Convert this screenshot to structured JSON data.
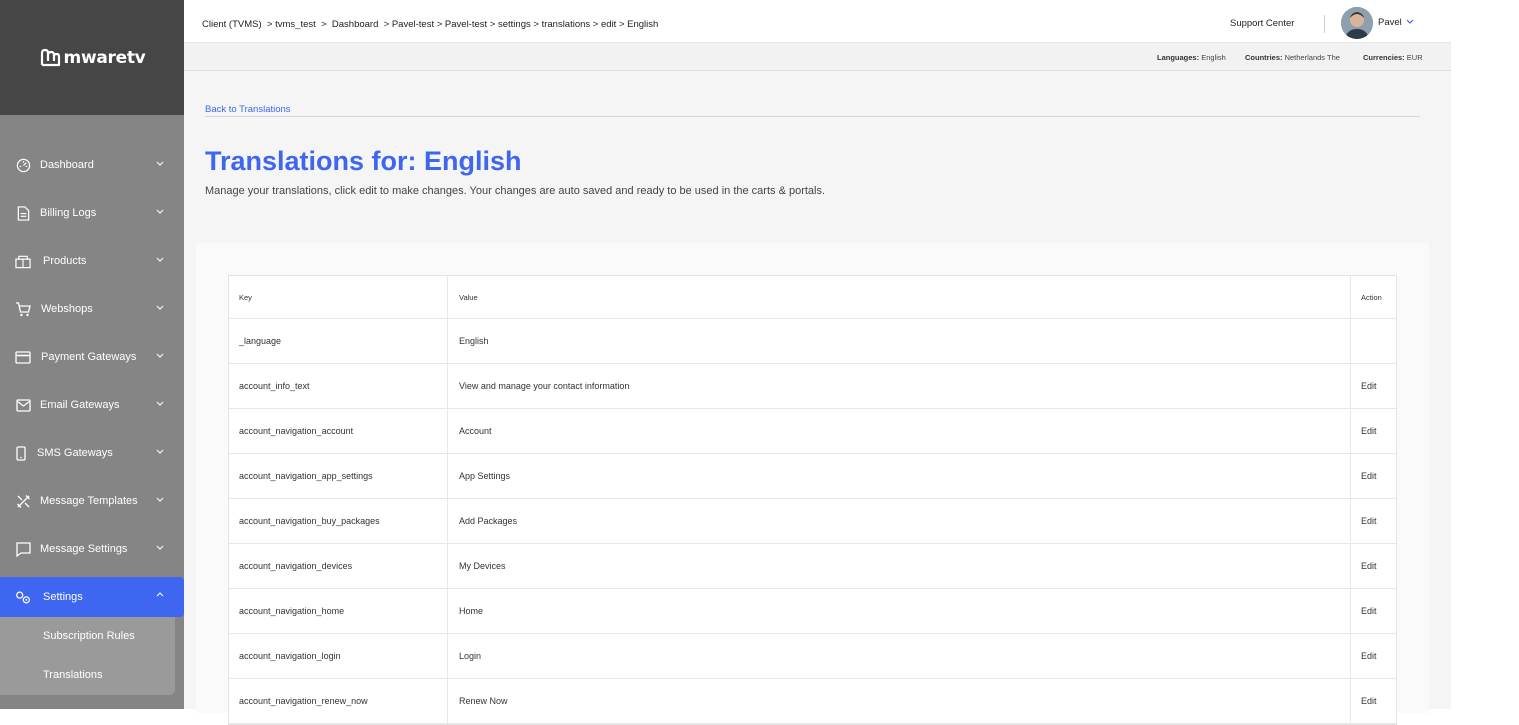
{
  "brand": {
    "name": "mwaretv"
  },
  "sidebar": {
    "items": [
      {
        "label": "Dashboard",
        "icon": "dashboard-icon"
      },
      {
        "label": "Billing Logs",
        "icon": "document-icon"
      },
      {
        "label": "Products",
        "icon": "package-icon"
      },
      {
        "label": "Webshops",
        "icon": "cart-icon"
      },
      {
        "label": "Payment Gateways",
        "icon": "credit-card-icon"
      },
      {
        "label": "Email Gateways",
        "icon": "mail-icon"
      },
      {
        "label": "SMS Gateways",
        "icon": "phone-icon"
      },
      {
        "label": "Message Templates",
        "icon": "tools-icon"
      },
      {
        "label": "Message Settings",
        "icon": "message-icon"
      },
      {
        "label": "Settings",
        "icon": "settings-icon",
        "active": true
      }
    ],
    "subitems": [
      {
        "label": "Subscription Rules"
      },
      {
        "label": "Translations"
      }
    ]
  },
  "topbar": {
    "breadcrumb": [
      "Client (TVMS)",
      "tvms_test",
      "Dashboard",
      "Pavel-test",
      "Pavel-test",
      "settings",
      "translations",
      "edit",
      "English"
    ],
    "support_label": "Support Center",
    "user_name": "Pavel"
  },
  "infobar": {
    "languages_label": "Languages:",
    "languages_value": "English",
    "countries_label": "Countries:",
    "countries_value": "Netherlands The",
    "currencies_label": "Currencies:",
    "currencies_value": "EUR"
  },
  "page": {
    "back_link": "Back to Translations",
    "title": "Translations for: English",
    "subtitle": "Manage your translations, click edit to make changes. Your changes are auto saved and ready to be used in the carts & portals."
  },
  "table": {
    "headers": {
      "key": "Key",
      "value": "Value",
      "action": "Action"
    },
    "rows": [
      {
        "key": "_language",
        "value": "English",
        "action": ""
      },
      {
        "key": "account_info_text",
        "value": "View and manage your contact information",
        "action": "Edit"
      },
      {
        "key": "account_navigation_account",
        "value": "Account",
        "action": "Edit"
      },
      {
        "key": "account_navigation_app_settings",
        "value": "App Settings",
        "action": "Edit"
      },
      {
        "key": "account_navigation_buy_packages",
        "value": "Add Packages",
        "action": "Edit"
      },
      {
        "key": "account_navigation_devices",
        "value": "My Devices",
        "action": "Edit"
      },
      {
        "key": "account_navigation_home",
        "value": "Home",
        "action": "Edit"
      },
      {
        "key": "account_navigation_login",
        "value": "Login",
        "action": "Edit"
      },
      {
        "key": "account_navigation_renew_now",
        "value": "Renew Now",
        "action": "Edit"
      }
    ]
  },
  "colors": {
    "accent": "#3f66f0",
    "sidebar": "#858585",
    "logo_bg": "#464646"
  }
}
